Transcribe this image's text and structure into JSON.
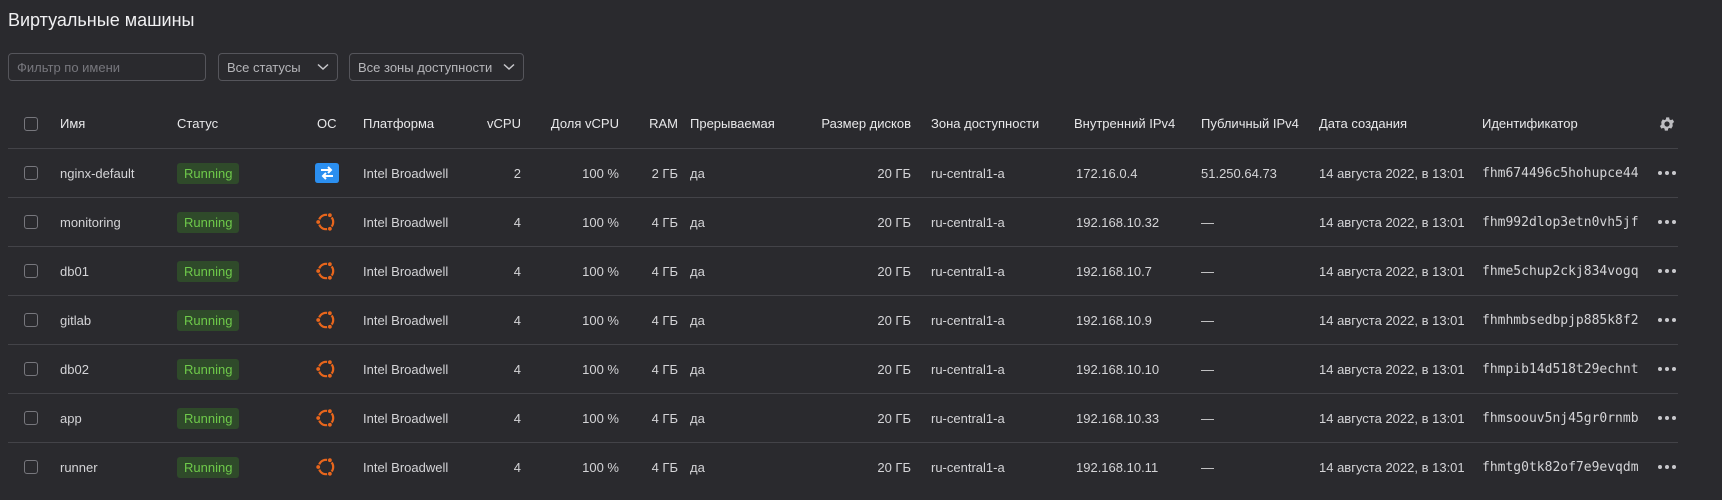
{
  "page": {
    "title": "Виртуальные машины"
  },
  "filters": {
    "name_placeholder": "Фильтр по имени",
    "status_select": "Все статусы",
    "zone_select": "Все зоны доступности"
  },
  "columns": {
    "name": "Имя",
    "status": "Статус",
    "os": "ОС",
    "platform": "Платформа",
    "vcpu": "vCPU",
    "vcpu_share": "Доля vCPU",
    "ram": "RAM",
    "preemptible": "Прерываемая",
    "disk_size": "Размер дисков",
    "zone": "Зона доступности",
    "internal_ip": "Внутренний IPv4",
    "public_ip": "Публичный IPv4",
    "created": "Дата создания",
    "id": "Идентификатор"
  },
  "colors": {
    "running_badge_bg": "#2f4a2a",
    "running_badge_text": "#6ec94a",
    "ubuntu_orange": "#e9661c",
    "debian_blue": "#2b8ff0"
  },
  "rows": [
    {
      "name": "nginx-default",
      "status": "Running",
      "os_icon": "lemp-blue-icon",
      "platform": "Intel Broadwell",
      "vcpu": "2",
      "vcpu_share": "100 %",
      "ram": "2 ГБ",
      "preemptible": "да",
      "disk_size": "20 ГБ",
      "zone": "ru-central1-a",
      "internal_ip": "172.16.0.4",
      "public_ip": "51.250.64.73",
      "created": "14 августа 2022, в 13:01",
      "id": "fhm674496c5hohupce44"
    },
    {
      "name": "monitoring",
      "status": "Running",
      "os_icon": "ubuntu-icon",
      "platform": "Intel Broadwell",
      "vcpu": "4",
      "vcpu_share": "100 %",
      "ram": "4 ГБ",
      "preemptible": "да",
      "disk_size": "20 ГБ",
      "zone": "ru-central1-a",
      "internal_ip": "192.168.10.32",
      "public_ip": "—",
      "created": "14 августа 2022, в 13:01",
      "id": "fhm992dlop3etn0vh5jf"
    },
    {
      "name": "db01",
      "status": "Running",
      "os_icon": "ubuntu-icon",
      "platform": "Intel Broadwell",
      "vcpu": "4",
      "vcpu_share": "100 %",
      "ram": "4 ГБ",
      "preemptible": "да",
      "disk_size": "20 ГБ",
      "zone": "ru-central1-a",
      "internal_ip": "192.168.10.7",
      "public_ip": "—",
      "created": "14 августа 2022, в 13:01",
      "id": "fhme5chup2ckj834vogq"
    },
    {
      "name": "gitlab",
      "status": "Running",
      "os_icon": "ubuntu-icon",
      "platform": "Intel Broadwell",
      "vcpu": "4",
      "vcpu_share": "100 %",
      "ram": "4 ГБ",
      "preemptible": "да",
      "disk_size": "20 ГБ",
      "zone": "ru-central1-a",
      "internal_ip": "192.168.10.9",
      "public_ip": "—",
      "created": "14 августа 2022, в 13:01",
      "id": "fhmhmbsedbpjp885k8f2"
    },
    {
      "name": "db02",
      "status": "Running",
      "os_icon": "ubuntu-icon",
      "platform": "Intel Broadwell",
      "vcpu": "4",
      "vcpu_share": "100 %",
      "ram": "4 ГБ",
      "preemptible": "да",
      "disk_size": "20 ГБ",
      "zone": "ru-central1-a",
      "internal_ip": "192.168.10.10",
      "public_ip": "—",
      "created": "14 августа 2022, в 13:01",
      "id": "fhmpib14d518t29echnt"
    },
    {
      "name": "app",
      "status": "Running",
      "os_icon": "ubuntu-icon",
      "platform": "Intel Broadwell",
      "vcpu": "4",
      "vcpu_share": "100 %",
      "ram": "4 ГБ",
      "preemptible": "да",
      "disk_size": "20 ГБ",
      "zone": "ru-central1-a",
      "internal_ip": "192.168.10.33",
      "public_ip": "—",
      "created": "14 августа 2022, в 13:01",
      "id": "fhmsoouv5nj45gr0rnmb"
    },
    {
      "name": "runner",
      "status": "Running",
      "os_icon": "ubuntu-icon",
      "platform": "Intel Broadwell",
      "vcpu": "4",
      "vcpu_share": "100 %",
      "ram": "4 ГБ",
      "preemptible": "да",
      "disk_size": "20 ГБ",
      "zone": "ru-central1-a",
      "internal_ip": "192.168.10.11",
      "public_ip": "—",
      "created": "14 августа 2022, в 13:01",
      "id": "fhmtg0tk82of7e9evqdm"
    }
  ]
}
